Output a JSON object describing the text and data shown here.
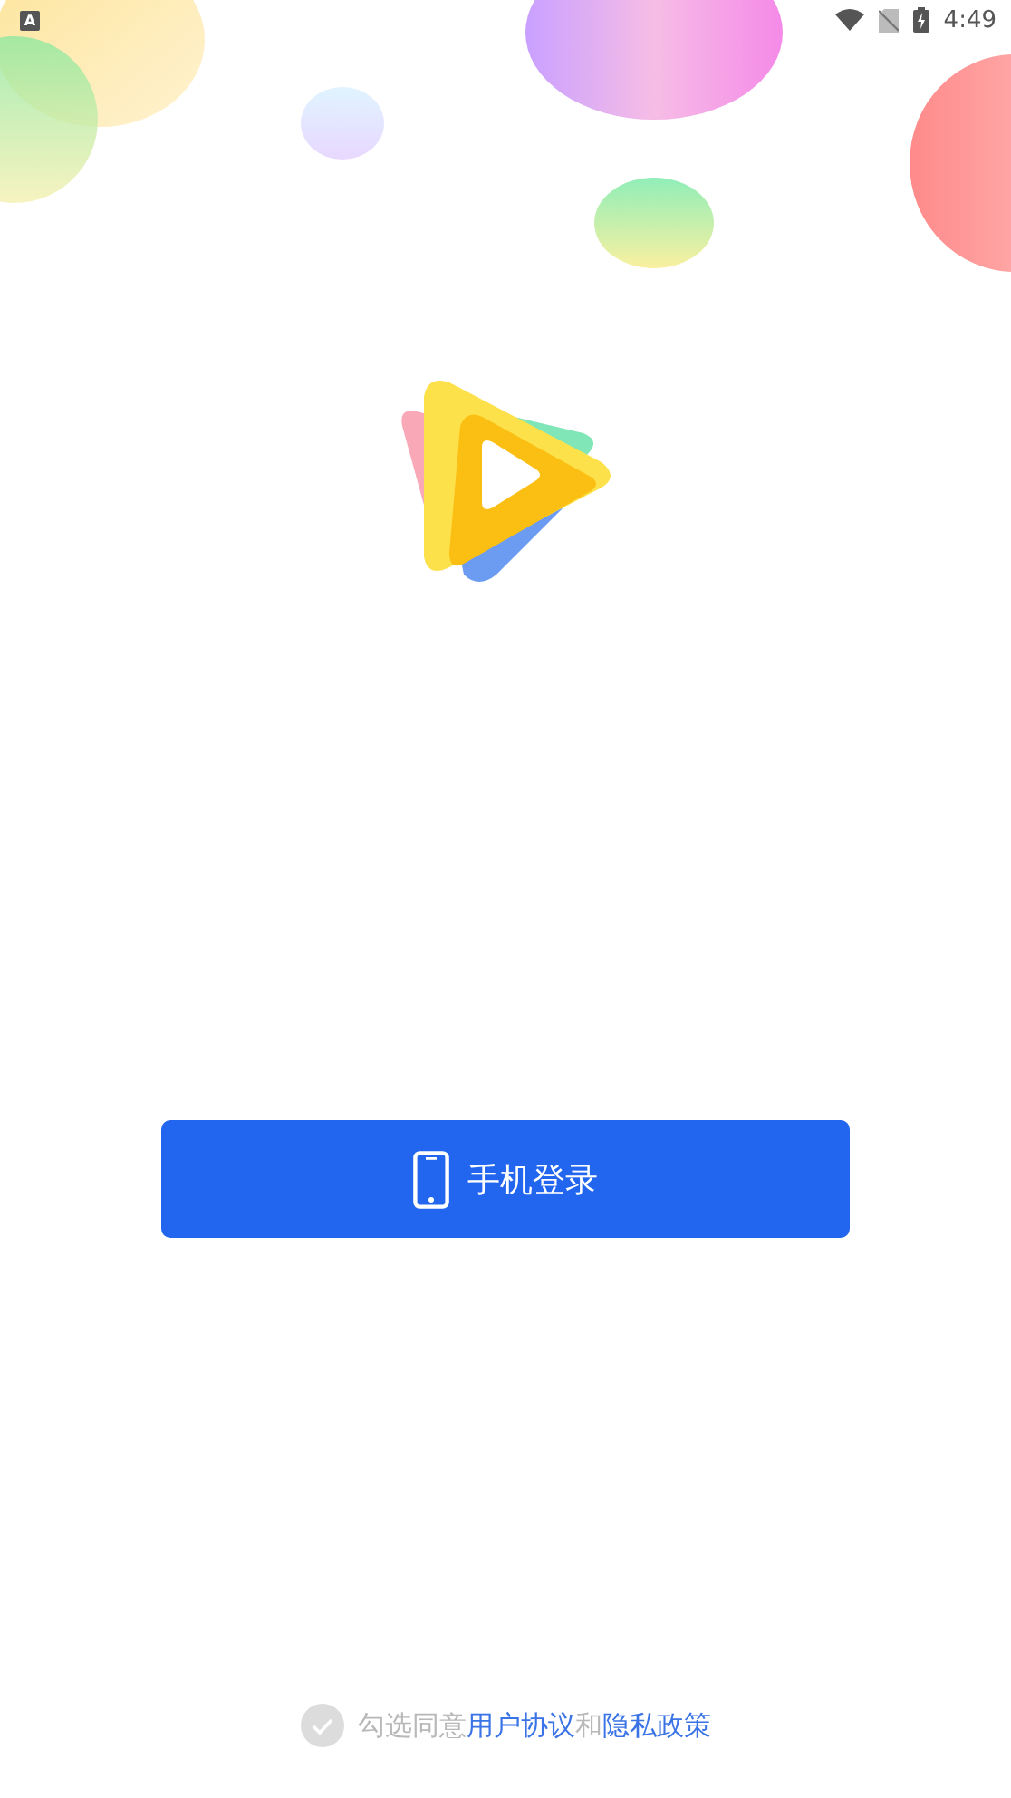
{
  "status_bar": {
    "notification": "A",
    "time": "4:49"
  },
  "login_button": {
    "label": "手机登录"
  },
  "agreement": {
    "checked": false,
    "prefix": "勾选同意",
    "terms_link": "用户协议",
    "joiner": "和",
    "privacy_link": "隐私政策"
  }
}
